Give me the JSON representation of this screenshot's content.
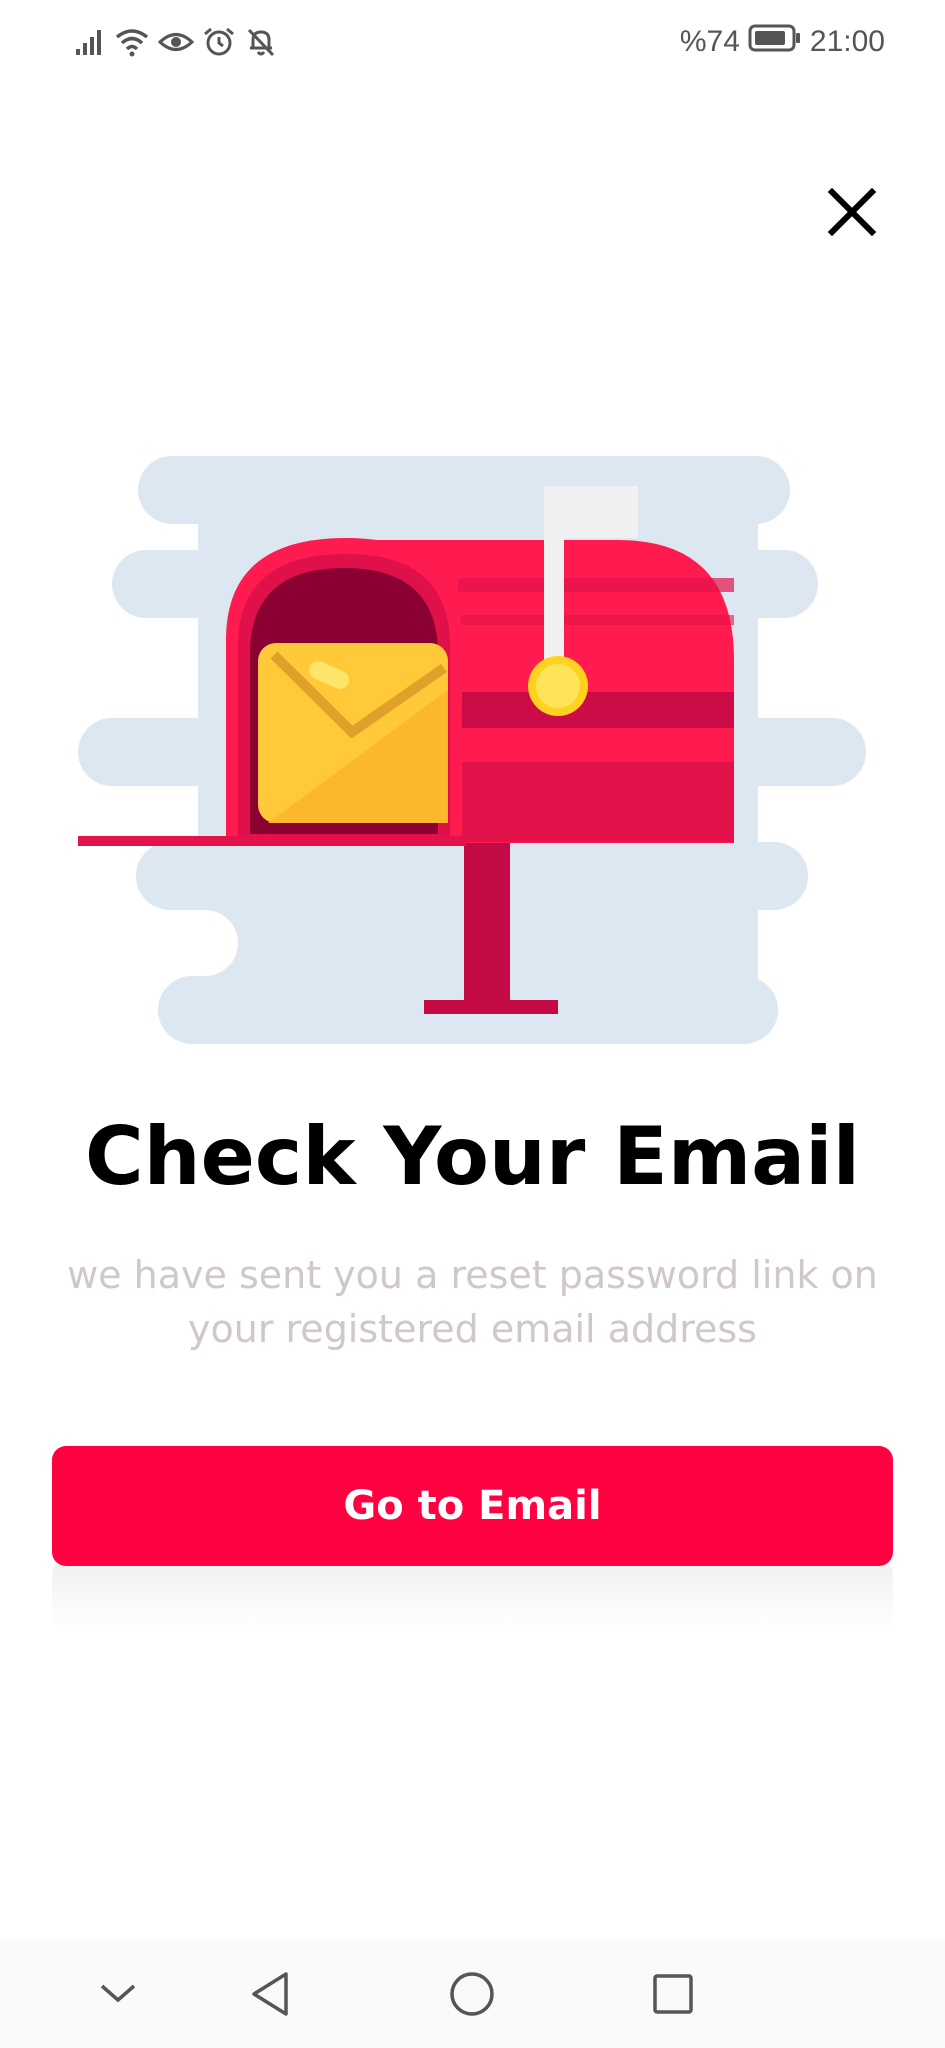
{
  "status_bar": {
    "battery": "%74",
    "time": "21:00",
    "icons": [
      "signal-icon",
      "wifi-icon",
      "eye-icon",
      "alarm-icon",
      "bell-off-icon",
      "battery-icon"
    ]
  },
  "header": {
    "close_icon": "close-icon"
  },
  "illustration": {
    "name": "mailbox-illustration",
    "colors": {
      "cloud": "#dde7f2",
      "mailbox_red": "#ff1a50",
      "mailbox_dark": "#c30a45",
      "mailbox_inner": "#8a0033",
      "envelope": "#ffc93a",
      "flag": "#f0f0f0",
      "knob": "#ffe45a"
    }
  },
  "main": {
    "title": "Check Your Email",
    "subtitle": "we have sent you a reset password link on your registered email address",
    "cta_label": "Go to Email"
  },
  "nav_bar": {
    "icons": [
      "chevron-down-icon",
      "back-icon",
      "home-icon",
      "recents-icon"
    ]
  },
  "colors": {
    "accent": "#ff0040",
    "subtitle_text": "#cfc7cd"
  }
}
